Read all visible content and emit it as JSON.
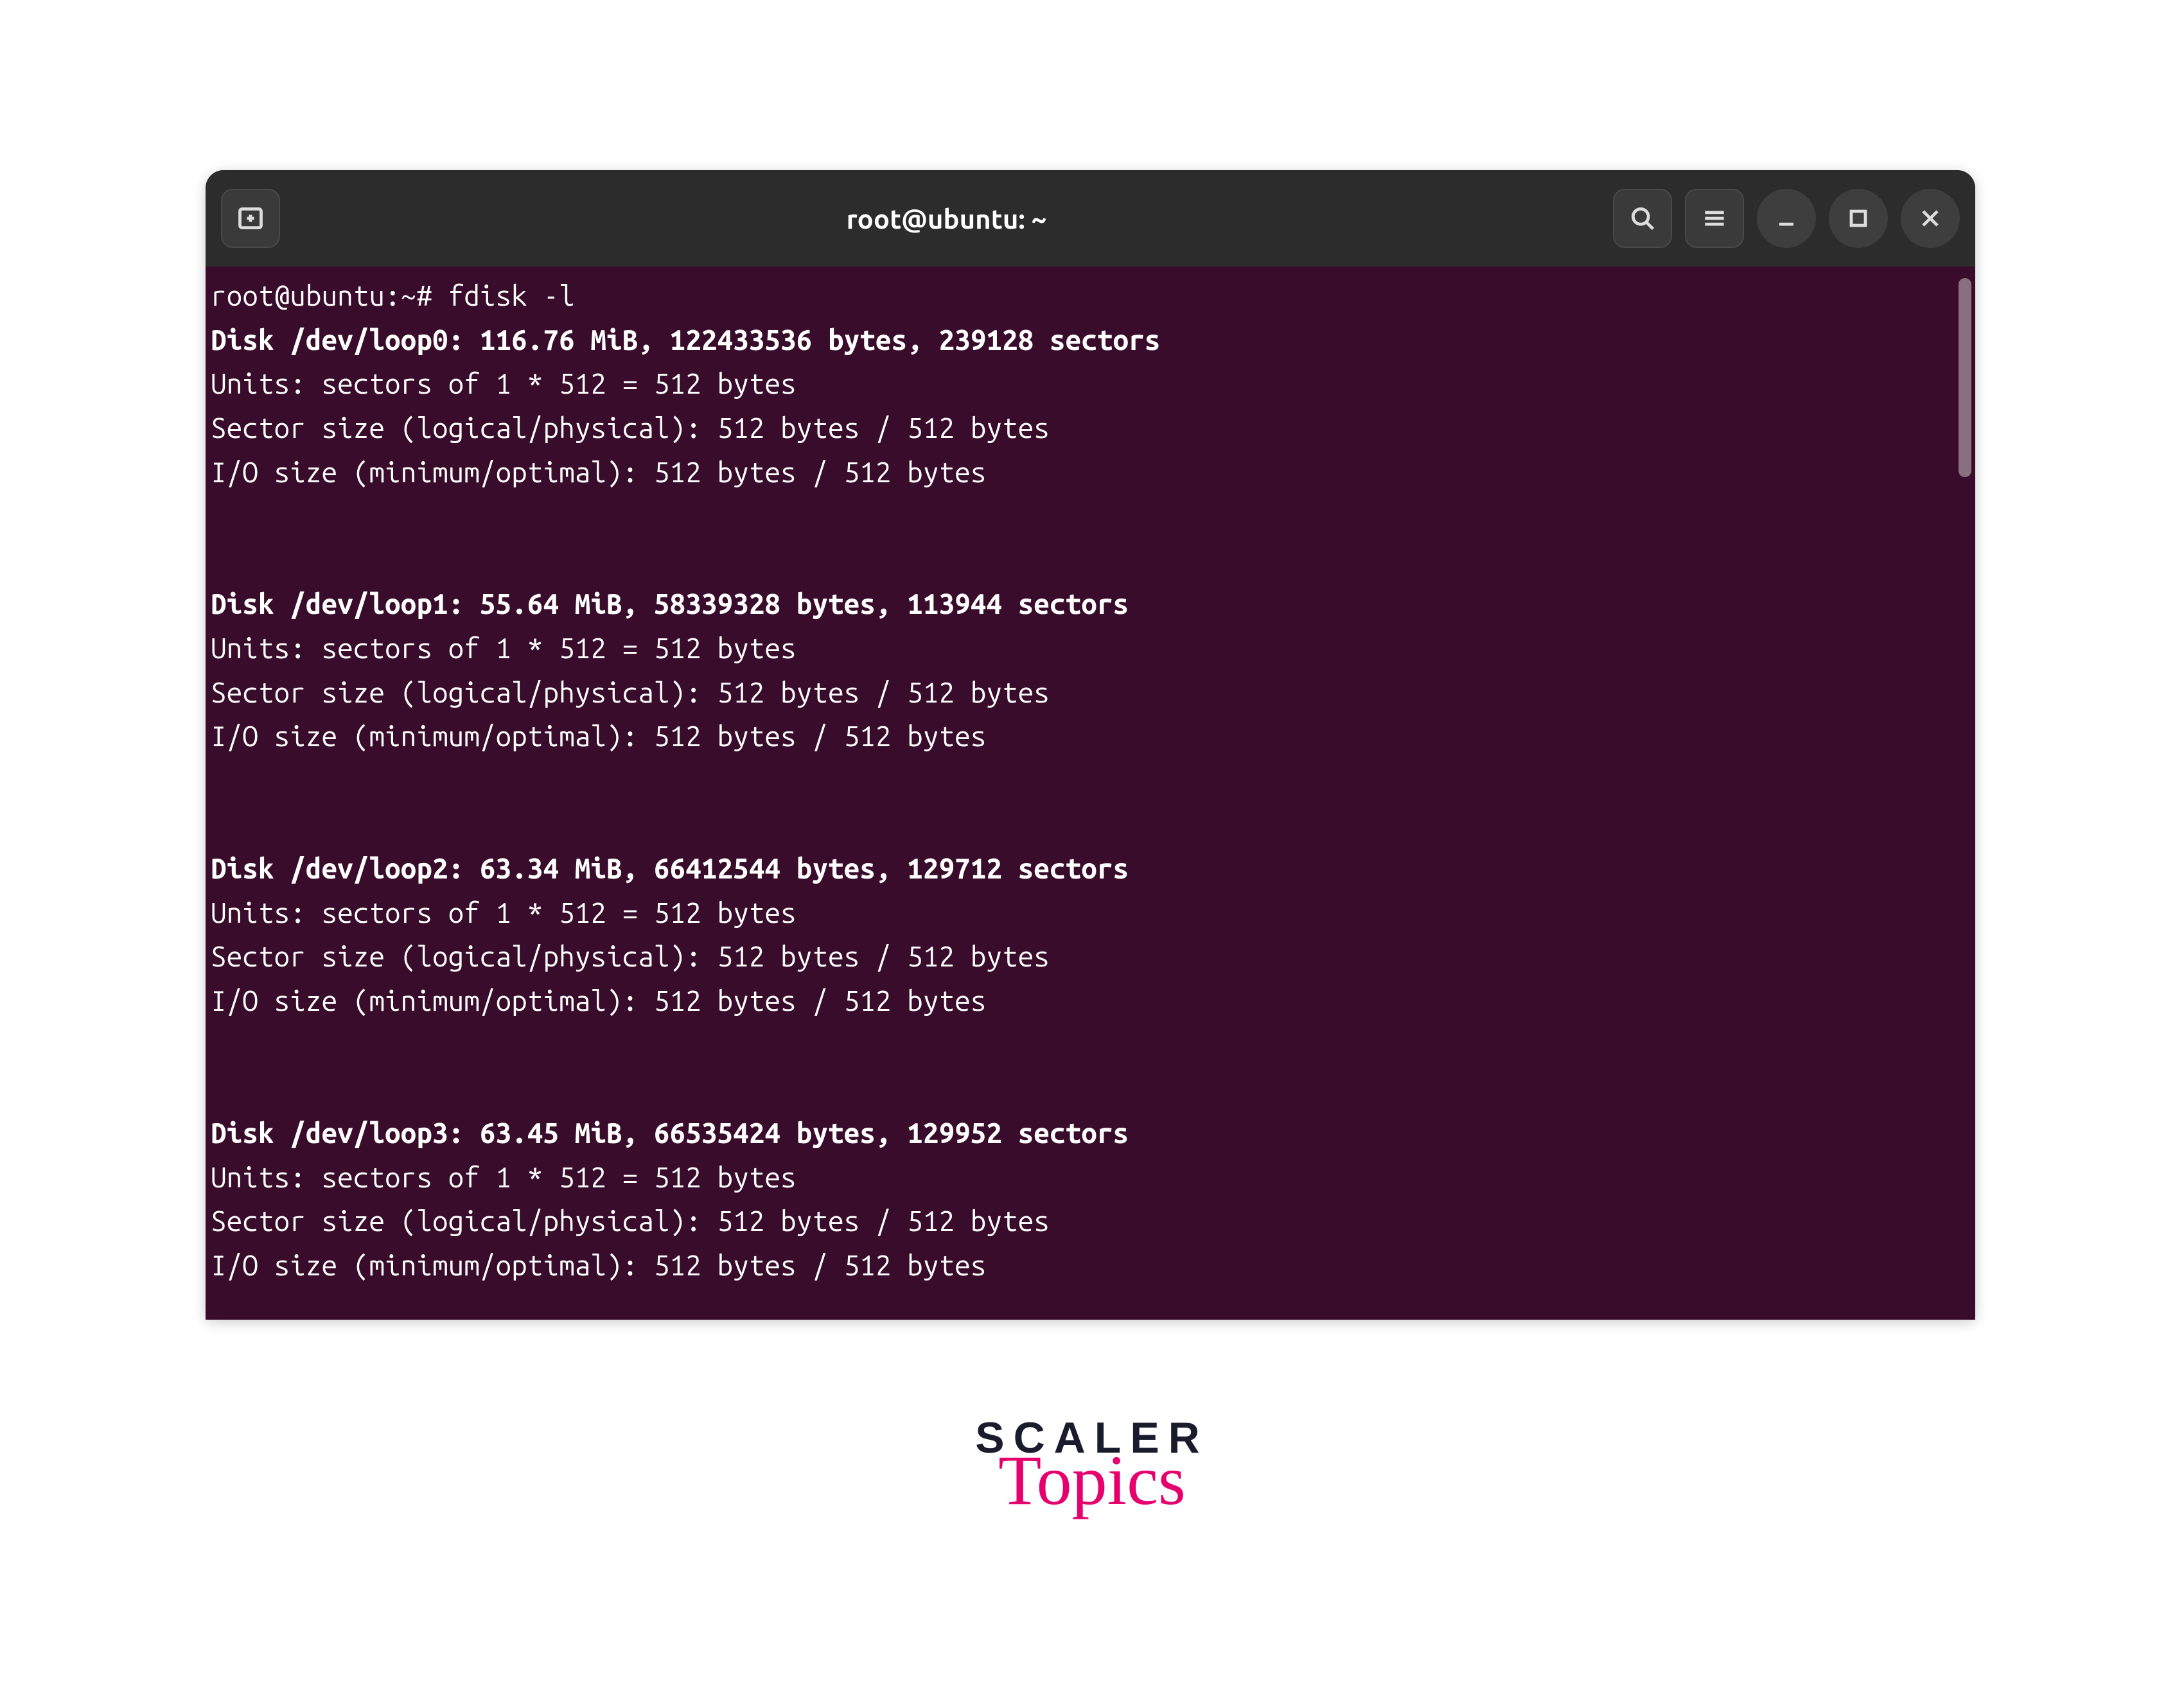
{
  "window": {
    "title": "root@ubuntu: ~",
    "icons": {
      "new_tab": "new-tab-icon",
      "search": "search-icon",
      "menu": "hamburger-icon",
      "minimize": "minimize-icon",
      "maximize": "maximize-icon",
      "close": "close-icon"
    }
  },
  "terminal": {
    "prompt": "root@ubuntu:~# ",
    "command": "fdisk -l",
    "blocks": [
      {
        "header": "Disk /dev/loop0: 116.76 MiB, 122433536 bytes, 239128 sectors",
        "units": "Units: sectors of 1 * 512 = 512 bytes",
        "sector": "Sector size (logical/physical): 512 bytes / 512 bytes",
        "io": "I/O size (minimum/optimal): 512 bytes / 512 bytes"
      },
      {
        "header": "Disk /dev/loop1: 55.64 MiB, 58339328 bytes, 113944 sectors",
        "units": "Units: sectors of 1 * 512 = 512 bytes",
        "sector": "Sector size (logical/physical): 512 bytes / 512 bytes",
        "io": "I/O size (minimum/optimal): 512 bytes / 512 bytes"
      },
      {
        "header": "Disk /dev/loop2: 63.34 MiB, 66412544 bytes, 129712 sectors",
        "units": "Units: sectors of 1 * 512 = 512 bytes",
        "sector": "Sector size (logical/physical): 512 bytes / 512 bytes",
        "io": "I/O size (minimum/optimal): 512 bytes / 512 bytes"
      },
      {
        "header": "Disk /dev/loop3: 63.45 MiB, 66535424 bytes, 129952 sectors",
        "units": "Units: sectors of 1 * 512 = 512 bytes",
        "sector": "Sector size (logical/physical): 512 bytes / 512 bytes",
        "io": "I/O size (minimum/optimal): 512 bytes / 512 bytes"
      }
    ]
  },
  "watermark": {
    "line1": "SCALER",
    "line2": "Topics"
  }
}
